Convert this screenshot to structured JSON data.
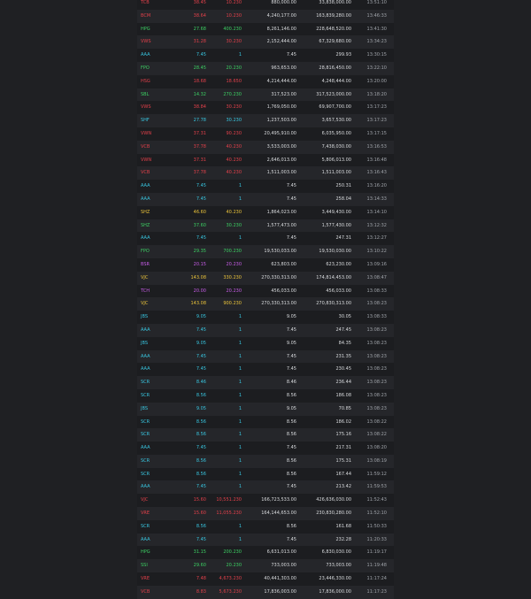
{
  "colors": {
    "background": "#1f2023",
    "green": "#3ccf63",
    "red": "#e2404a",
    "yellow": "#e9c23a",
    "cyan": "#38c6e0",
    "purple": "#c65ce6"
  },
  "rows": [
    {
      "symbol": "TCB",
      "price": "38.45",
      "change": "10.230",
      "qty": "880,000.00",
      "value": "33,838,000.00",
      "time": "13:51:10",
      "color": "red"
    },
    {
      "symbol": "BCM",
      "price": "38.64",
      "change": "10.230",
      "qty": "4,240,177.00",
      "value": "163,839,280.00",
      "time": "13:46:33",
      "color": "red"
    },
    {
      "symbol": "HPG",
      "price": "27.68",
      "change": "400.230",
      "qty": "8,261,146.00",
      "value": "228,648,520.00",
      "time": "13:41:30",
      "color": "green"
    },
    {
      "symbol": "VWS",
      "price": "31.28",
      "change": "30.230",
      "qty": "2,152,444.00",
      "value": "67,329,680.00",
      "time": "13:34:23",
      "color": "red"
    },
    {
      "symbol": "AAA",
      "price": "7.45",
      "change": "1",
      "qty": "7.45",
      "value": "299.93",
      "time": "13:30:15",
      "color": "cyan"
    },
    {
      "symbol": "FPO",
      "price": "28.45",
      "change": "20.230",
      "qty": "963,653.00",
      "value": "28,816,450.00",
      "time": "13:22:10",
      "color": "green"
    },
    {
      "symbol": "HSG",
      "price": "18.68",
      "change": "18.650",
      "qty": "4,214,444.00",
      "value": "4,248,444.00",
      "time": "13:20:00",
      "color": "red"
    },
    {
      "symbol": "SBL",
      "price": "14.32",
      "change": "270.230",
      "qty": "317,523.00",
      "value": "317,523,000.00",
      "time": "13:18:20",
      "color": "green"
    },
    {
      "symbol": "VWS",
      "price": "38.84",
      "change": "30.230",
      "qty": "1,769,050.00",
      "value": "69,907,700.00",
      "time": "13:17:23",
      "color": "red"
    },
    {
      "symbol": "SHF",
      "price": "27.78",
      "change": "30.230",
      "qty": "1,237,503.00",
      "value": "3,657,530.00",
      "time": "13:17:23",
      "color": "cyan"
    },
    {
      "symbol": "VWN",
      "price": "37.31",
      "change": "90.230",
      "qty": "20,495,910.00",
      "value": "6,035,950.00",
      "time": "13:17:15",
      "color": "red"
    },
    {
      "symbol": "VCB",
      "price": "37.78",
      "change": "40.230",
      "qty": "3,533,003.00",
      "value": "7,438,030.00",
      "time": "13:16:53",
      "color": "red"
    },
    {
      "symbol": "VWN",
      "price": "37.31",
      "change": "40.230",
      "qty": "2,646,013.00",
      "value": "5,806,013.00",
      "time": "13:16:48",
      "color": "red"
    },
    {
      "symbol": "VCB",
      "price": "37.78",
      "change": "40.230",
      "qty": "1,511,003.00",
      "value": "1,511,003.00",
      "time": "13:16:43",
      "color": "red"
    },
    {
      "symbol": "AAA",
      "price": "7.45",
      "change": "1",
      "qty": "7.45",
      "value": "250.31",
      "time": "13:16:20",
      "color": "cyan"
    },
    {
      "symbol": "AAA",
      "price": "7.45",
      "change": "1",
      "qty": "7.45",
      "value": "258.04",
      "time": "13:14:33",
      "color": "cyan"
    },
    {
      "symbol": "SHZ",
      "price": "46.60",
      "change": "40.230",
      "qty": "1,864,023.00",
      "value": "3,449,430.00",
      "time": "13:14:10",
      "color": "yellow"
    },
    {
      "symbol": "SHZ",
      "price": "37.60",
      "change": "30.230",
      "qty": "1,577,473.00",
      "value": "1,577,430.00",
      "time": "13:12:32",
      "color": "green"
    },
    {
      "symbol": "AAA",
      "price": "7.45",
      "change": "1",
      "qty": "7.45",
      "value": "247.31",
      "time": "13:12:27",
      "color": "cyan"
    },
    {
      "symbol": "FPO",
      "price": "29.35",
      "change": "700.230",
      "qty": "19,530,033.00",
      "value": "19,530,030.00",
      "time": "13:10:22",
      "color": "green"
    },
    {
      "symbol": "BSR",
      "price": "20.15",
      "change": "20.230",
      "qty": "623,803.00",
      "value": "623,230.00",
      "time": "13:09:16",
      "color": "purple"
    },
    {
      "symbol": "VJC",
      "price": "143.08",
      "change": "330.230",
      "qty": "270,330,313.00",
      "value": "174,814,453.00",
      "time": "13:08:47",
      "color": "yellow"
    },
    {
      "symbol": "TCH",
      "price": "20.00",
      "change": "20.230",
      "qty": "456,033.00",
      "value": "456,033.00",
      "time": "13:08:33",
      "color": "purple"
    },
    {
      "symbol": "VJC",
      "price": "143.08",
      "change": "900.230",
      "qty": "270,330,313.00",
      "value": "270,830,313.00",
      "time": "13:08:23",
      "color": "yellow"
    },
    {
      "symbol": "JBS",
      "price": "9.05",
      "change": "1",
      "qty": "9.05",
      "value": "30.05",
      "time": "13:08:33",
      "color": "cyan"
    },
    {
      "symbol": "AAA",
      "price": "7.45",
      "change": "1",
      "qty": "7.45",
      "value": "247.45",
      "time": "13:08:23",
      "color": "cyan"
    },
    {
      "symbol": "JBS",
      "price": "9.05",
      "change": "1",
      "qty": "9.05",
      "value": "84.35",
      "time": "13:08:23",
      "color": "cyan"
    },
    {
      "symbol": "AAA",
      "price": "7.45",
      "change": "1",
      "qty": "7.45",
      "value": "231.35",
      "time": "13:08:23",
      "color": "cyan"
    },
    {
      "symbol": "AAA",
      "price": "7.45",
      "change": "1",
      "qty": "7.45",
      "value": "230.45",
      "time": "13:08:23",
      "color": "cyan"
    },
    {
      "symbol": "SCR",
      "price": "8.46",
      "change": "1",
      "qty": "8.46",
      "value": "236.44",
      "time": "13:08:23",
      "color": "cyan"
    },
    {
      "symbol": "SCR",
      "price": "8.56",
      "change": "1",
      "qty": "8.56",
      "value": "186.08",
      "time": "13:08:23",
      "color": "cyan"
    },
    {
      "symbol": "JBS",
      "price": "9.05",
      "change": "1",
      "qty": "9.05",
      "value": "70.85",
      "time": "13:08:23",
      "color": "cyan"
    },
    {
      "symbol": "SCR",
      "price": "8.56",
      "change": "1",
      "qty": "8.56",
      "value": "186.02",
      "time": "13:08:22",
      "color": "cyan"
    },
    {
      "symbol": "SCR",
      "price": "8.56",
      "change": "1",
      "qty": "8.56",
      "value": "175.16",
      "time": "13:08:22",
      "color": "cyan"
    },
    {
      "symbol": "AAA",
      "price": "7.45",
      "change": "1",
      "qty": "7.45",
      "value": "217.31",
      "time": "13:08:20",
      "color": "cyan"
    },
    {
      "symbol": "SCR",
      "price": "8.56",
      "change": "1",
      "qty": "8.56",
      "value": "175.31",
      "time": "13:08:19",
      "color": "cyan"
    },
    {
      "symbol": "SCR",
      "price": "8.56",
      "change": "1",
      "qty": "8.56",
      "value": "167.44",
      "time": "11:59:12",
      "color": "cyan"
    },
    {
      "symbol": "AAA",
      "price": "7.45",
      "change": "1",
      "qty": "7.45",
      "value": "213.42",
      "time": "11:59:53",
      "color": "cyan"
    },
    {
      "symbol": "VJC",
      "price": "15.60",
      "change": "10,551.230",
      "qty": "166,723,533.00",
      "value": "426,636,030.00",
      "time": "11:52:43",
      "color": "red"
    },
    {
      "symbol": "VRE",
      "price": "15.60",
      "change": "11,055.230",
      "qty": "164,144,653.00",
      "value": "230,830,280.00",
      "time": "11:52:10",
      "color": "red"
    },
    {
      "symbol": "SCR",
      "price": "8.56",
      "change": "1",
      "qty": "8.56",
      "value": "161.68",
      "time": "11:50:33",
      "color": "cyan"
    },
    {
      "symbol": "AAA",
      "price": "7.45",
      "change": "1",
      "qty": "7.45",
      "value": "232.28",
      "time": "11:20:33",
      "color": "cyan"
    },
    {
      "symbol": "HPG",
      "price": "31.15",
      "change": "200.230",
      "qty": "6,631,013.00",
      "value": "6,830,030.00",
      "time": "11:19:17",
      "color": "green"
    },
    {
      "symbol": "SSI",
      "price": "29.60",
      "change": "20.230",
      "qty": "733,003.00",
      "value": "733,003.00",
      "time": "11:19:48",
      "color": "green"
    },
    {
      "symbol": "VRE",
      "price": "7.48",
      "change": "4,673.230",
      "qty": "40,441,303.00",
      "value": "23,446,330.00",
      "time": "11:17:24",
      "color": "red"
    },
    {
      "symbol": "VCB",
      "price": "8.83",
      "change": "5,673.230",
      "qty": "17,836,003.00",
      "value": "17,836,000.00",
      "time": "11:17:23",
      "color": "red"
    }
  ]
}
